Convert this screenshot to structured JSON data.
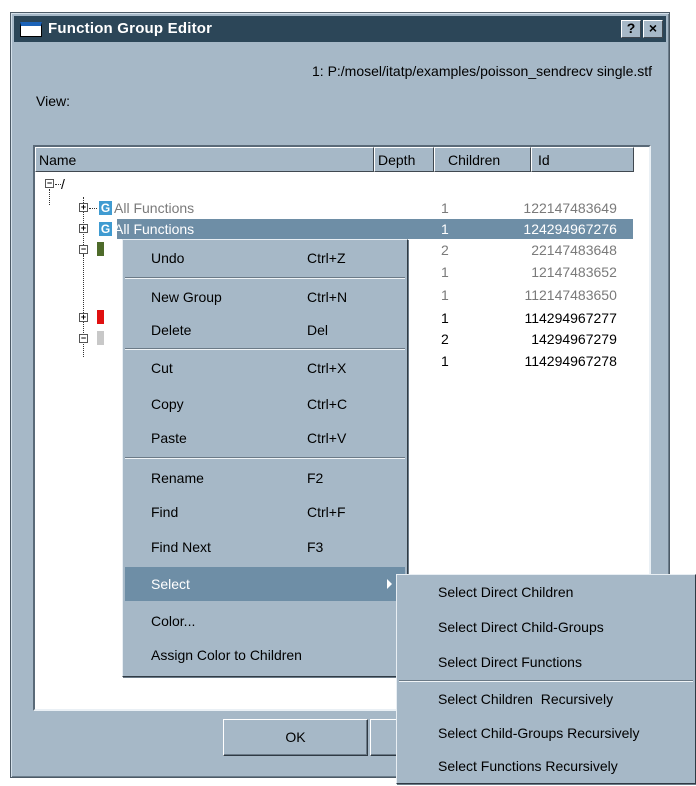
{
  "window": {
    "title": "Function Group Editor",
    "help_label": "?",
    "close_label": "×"
  },
  "view": {
    "label": "View:",
    "value": "1: P:/mosel/itatp/examples/poisson_sendrecv single.stf"
  },
  "columns": [
    "Name",
    "Depth",
    "Children",
    "Id"
  ],
  "tree": {
    "root_label": "/",
    "rows": [
      {
        "badge": "G",
        "name": "All Functions",
        "depth": "1",
        "children": "12",
        "id": "2147483649",
        "style": "grey"
      },
      {
        "badge": "G",
        "name": "All Functions",
        "depth": "1",
        "children": "12",
        "id": "4294967276",
        "style": "selected"
      },
      {
        "depth": "2",
        "children": "2",
        "id": "2147483648",
        "style": "grey"
      },
      {
        "depth": "1",
        "children": "1",
        "id": "2147483652",
        "style": "grey"
      },
      {
        "depth": "1",
        "children": "11",
        "id": "2147483650",
        "style": "grey"
      },
      {
        "depth": "1",
        "children": "11",
        "id": "4294967277",
        "style": "normal"
      },
      {
        "depth": "2",
        "children": "1",
        "id": "4294967279",
        "style": "normal"
      },
      {
        "depth": "1",
        "children": "11",
        "id": "4294967278",
        "style": "normal"
      }
    ]
  },
  "context_menu": {
    "items": [
      {
        "label": "Undo",
        "shortcut": "Ctrl+Z"
      },
      {
        "label": "New Group",
        "shortcut": "Ctrl+N"
      },
      {
        "label": "Delete",
        "shortcut": "Del"
      },
      {
        "label": "Cut",
        "shortcut": "Ctrl+X"
      },
      {
        "label": "Copy",
        "shortcut": "Ctrl+C"
      },
      {
        "label": "Paste",
        "shortcut": "Ctrl+V"
      },
      {
        "label": "Rename",
        "shortcut": "F2"
      },
      {
        "label": "Find",
        "shortcut": "Ctrl+F"
      },
      {
        "label": "Find Next",
        "shortcut": "F3"
      },
      {
        "label": "Select",
        "shortcut": ""
      },
      {
        "label": "Color...",
        "shortcut": ""
      },
      {
        "label": "Assign Color to Children",
        "shortcut": ""
      }
    ]
  },
  "select_submenu": {
    "items": [
      "Select Direct Children",
      "Select Direct Child-Groups",
      "Select Direct Functions",
      "Select Children  Recursively",
      "Select Child-Groups Recursively",
      "Select Functions Recursively"
    ]
  },
  "buttons": {
    "ok_label": "OK"
  },
  "colors": {
    "titlebar": "#2c4658",
    "dialog_face": "#a6b8c7",
    "selection": "#6e8ea6",
    "group_badge": "#3f9bd1",
    "chip_green": "#4e6b2a",
    "chip_red": "#e01010",
    "chip_grey": "#c8c8c8"
  }
}
